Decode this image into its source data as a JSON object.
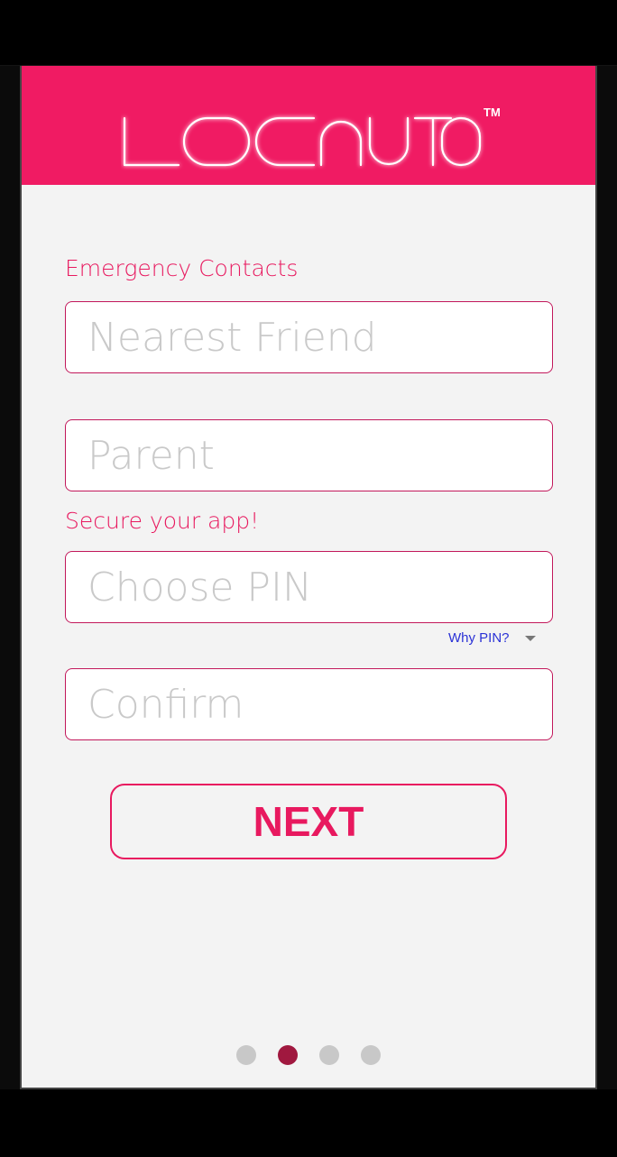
{
  "header": {
    "logo_text": "LOCNUTO",
    "trademark": "TM",
    "bg_color": "#f01b63"
  },
  "emergency": {
    "label": "Emergency Contacts",
    "nearest_friend_placeholder": "Nearest Friend",
    "parent_placeholder": "Parent"
  },
  "secure": {
    "label": "Secure your app!",
    "pin_placeholder": "Choose PIN",
    "why_pin": "Why PIN?",
    "confirm_placeholder": "Confirm"
  },
  "actions": {
    "next_label": "NEXT"
  },
  "pager": {
    "total": 4,
    "active_index": 1
  },
  "colors": {
    "accent": "#e8195f",
    "link": "#2b32d6",
    "dot_active": "#a0183f",
    "dot_inactive": "#c8c8c8"
  }
}
